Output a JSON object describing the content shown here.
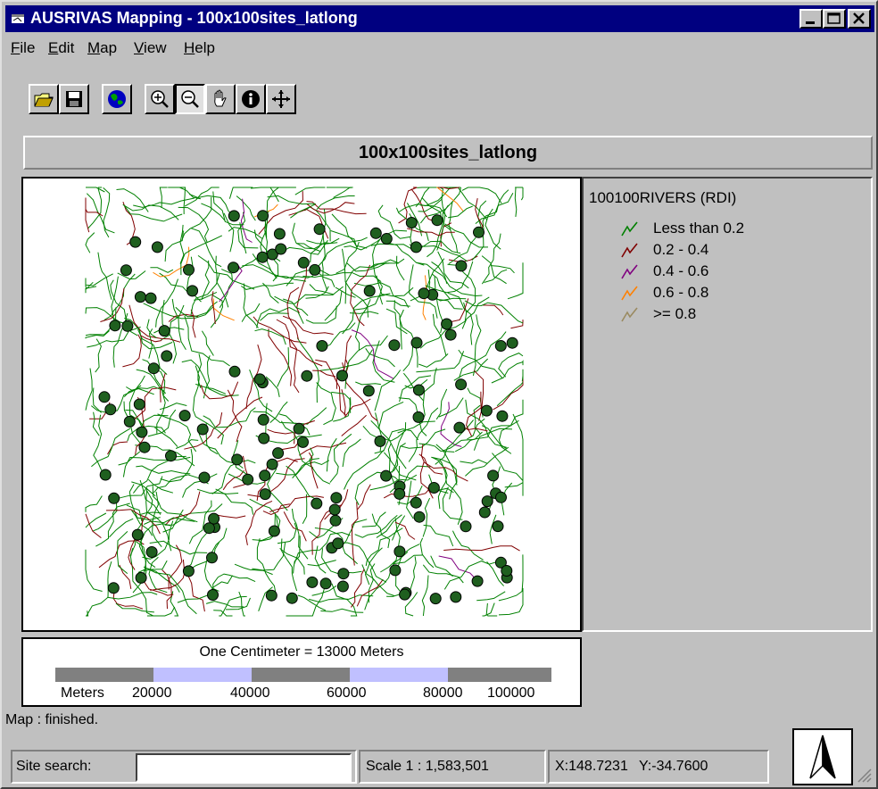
{
  "window": {
    "title": "AUSRIVAS Mapping - 100x100sites_latlong",
    "controls": [
      "minimize",
      "maximize",
      "close"
    ]
  },
  "menu": [
    {
      "label": "File",
      "accel": "F",
      "rest": "ile"
    },
    {
      "label": "Edit",
      "accel": "E",
      "rest": "dit"
    },
    {
      "label": "Map",
      "accel": "M",
      "rest": "ap"
    },
    {
      "label": "View",
      "accel": "V",
      "rest": "iew"
    },
    {
      "label": "Help",
      "accel": "H",
      "rest": "elp"
    }
  ],
  "toolbar": {
    "buttons": [
      {
        "icon": "open-folder-icon"
      },
      {
        "icon": "save-disk-icon"
      },
      {
        "icon": "globe-icon"
      },
      {
        "icon": "zoom-in-icon"
      },
      {
        "icon": "zoom-out-icon",
        "pressed": true
      },
      {
        "icon": "pan-hand-icon"
      },
      {
        "icon": "info-icon"
      },
      {
        "icon": "move-arrows-icon"
      }
    ]
  },
  "map": {
    "title": "100x100sites_latlong"
  },
  "legend": {
    "layer": "100100RIVERS (RDI)",
    "classes": [
      {
        "label": "Less than 0.2",
        "color": "#008000"
      },
      {
        "label": "0.2 - 0.4",
        "color": "#800000"
      },
      {
        "label": "0.4 - 0.6",
        "color": "#800080"
      },
      {
        "label": "0.6 - 0.8",
        "color": "#ff8000"
      },
      {
        "label": ">= 0.8",
        "color": "#9a8a60"
      }
    ]
  },
  "scale": {
    "caption": "One Centimeter = 13000 Meters",
    "unit_label": "Meters",
    "ticks": [
      "20000",
      "40000",
      "60000",
      "80000",
      "100000"
    ],
    "colors": {
      "dark": "#808080",
      "light": "#c0c0ff"
    }
  },
  "status": {
    "message": "Map : finished.",
    "site_search_label": "Site search:",
    "site_search_value": "",
    "scale_text": "Scale 1 : 1,583,501",
    "x_text": "X:148.7231",
    "y_text": "Y:-34.7600"
  },
  "colors": {
    "titlebar": "#000080",
    "face": "#c0c0c0",
    "site": "#1f5f1f"
  }
}
